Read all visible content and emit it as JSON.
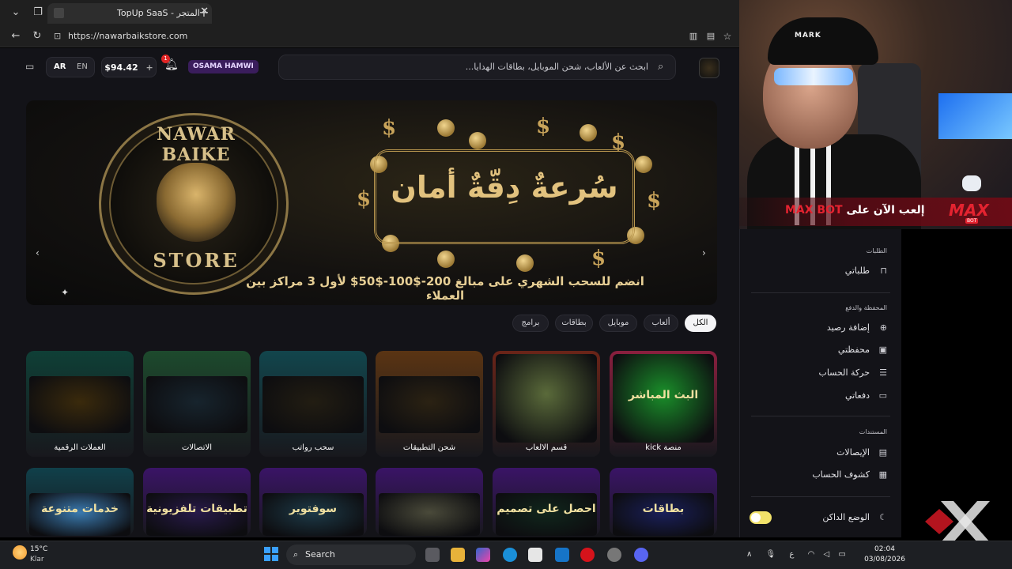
{
  "browser": {
    "tab_title": "TopUp SaaS - المتجر",
    "tab_close": "✕",
    "new_tab": "+",
    "url": "https://nawarbaikstore.com"
  },
  "header": {
    "search_placeholder": "ابحث عن الألعاب، شحن الموبايل، بطاقات الهدايا...",
    "user_name": "OSAMA HAMWI",
    "balance": "$94.42",
    "balance_add": "+",
    "notification_count": "1",
    "lang_ar": "AR",
    "lang_en": "EN"
  },
  "banner": {
    "brand_top": "NAWAR BAIKE",
    "brand_bottom": "STORE",
    "slogan": "سُرعةٌ دِقّةٌ أمان",
    "promo": "انضم للسحب الشهري على مبالغ 200-$100-$50$ لأول 3 مراكز بين العملاء",
    "prev": "‹",
    "next": "›"
  },
  "filters": [
    {
      "label": "الكل",
      "active": true
    },
    {
      "label": "ألعاب",
      "active": false
    },
    {
      "label": "موبايل",
      "active": false
    },
    {
      "label": "بطاقات",
      "active": false
    },
    {
      "label": "برامج",
      "active": false
    }
  ],
  "cards_row1": [
    {
      "label": "منصة kick",
      "bg": "#8a1f3e",
      "img": "#1a8f2a",
      "caption": "البث المباشر"
    },
    {
      "label": "قسم الالعاب",
      "bg": "#6b2418",
      "img": "#5a6a3a",
      "caption": ""
    },
    {
      "label": "شحن التطبيقات",
      "bg": "#5a3413",
      "img": "#2b2213",
      "caption": ""
    },
    {
      "label": "سحب رواتب",
      "bg": "#12454c",
      "img": "#221d12",
      "caption": ""
    },
    {
      "label": "الاتصالات",
      "bg": "#1d4a2d",
      "img": "#17242d",
      "caption": ""
    },
    {
      "label": "العملات الرقمية",
      "bg": "#0f3f36",
      "img": "#3a2a0c",
      "caption": ""
    }
  ],
  "cards_row2": [
    {
      "bg": "#3a1466",
      "img": "#1a1f5a",
      "caption": "بطاقات"
    },
    {
      "bg": "#3a1466",
      "img": "#10261c",
      "caption": "احصل على تصميم"
    },
    {
      "bg": "#3a1466",
      "img": "#4a4a3a",
      "caption": ""
    },
    {
      "bg": "#3a1466",
      "img": "#1d3a48",
      "caption": "سوفتوير"
    },
    {
      "bg": "#3a1466",
      "img": "#281a4a",
      "caption": "تطبيقات تلفزيونية"
    },
    {
      "bg": "#10404a",
      "img": "#3a7ab0",
      "caption": "خدمات متنوعة"
    }
  ],
  "webcam": {
    "cap_text": "MARK",
    "promo_prefix": "إلعب الآن على",
    "promo_brand": "MAX BOT",
    "logo": "MAX",
    "logo_sub": "BOT"
  },
  "sidebar": {
    "orders_title": "الطلبات",
    "my_orders": "طلباتي",
    "wallet_title": "المحفظة والدفع",
    "add_balance": "إضافة رصيد",
    "my_wallet": "محفظتي",
    "account_activity": "حركة الحساب",
    "my_payments": "دفعاتي",
    "documents_title": "المستندات",
    "receipts": "الإيصالات",
    "statements": "كشوف الحساب",
    "dark_mode": "الوضع الداكن"
  },
  "taskbar": {
    "temperature": "15°C",
    "weather": "Klar",
    "search": "Search",
    "lang_indicator": "ع",
    "time": "02:04",
    "date": "03/08/2026"
  }
}
